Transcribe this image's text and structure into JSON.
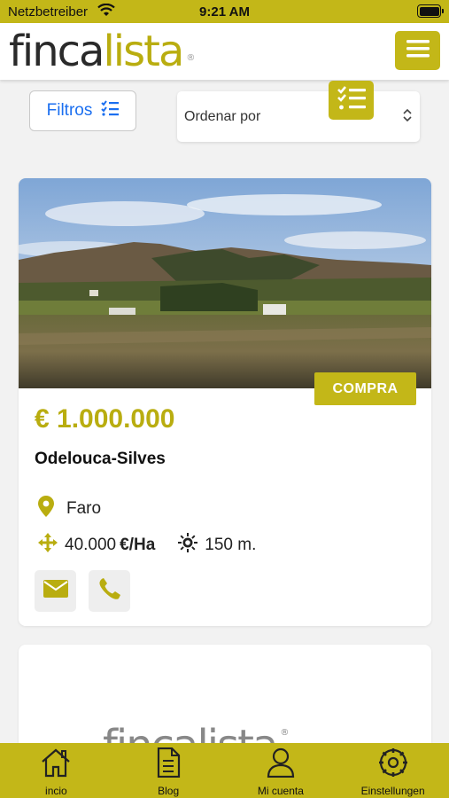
{
  "status_bar": {
    "carrier": "Netzbetreiber",
    "time": "9:21 AM"
  },
  "header": {
    "logo_part1": "finca",
    "logo_part2": "lista",
    "logo_mark": "®",
    "menu_icon": "hamburger-menu-icon"
  },
  "toolbar": {
    "filters_label": "Filtros",
    "filters_icon": "list-checks-icon",
    "sort_label": "Ordenar por",
    "sort_icon": "checklist-icon"
  },
  "listings": [
    {
      "badge": "COMPRA",
      "price": "€ 1.000.000",
      "title": "Odelouca-Silves",
      "location": "Faro",
      "area": "40.000",
      "area_unit": "€/Ha",
      "altitude": "150 m.",
      "photo": "landscape-photo"
    }
  ],
  "placeholder_card": {
    "logo_part1": "finca",
    "logo_part2": "lista",
    "logo_mark": "®"
  },
  "tabbar": {
    "items": [
      {
        "label": "incio",
        "icon": "home-icon"
      },
      {
        "label": "Blog",
        "icon": "document-icon"
      },
      {
        "label": "Mi cuenta",
        "icon": "user-icon"
      },
      {
        "label": "Einstellungen",
        "icon": "settings-icon"
      }
    ]
  },
  "colors": {
    "brand": "#c3b718",
    "accent_blue": "#1b6ff0"
  }
}
